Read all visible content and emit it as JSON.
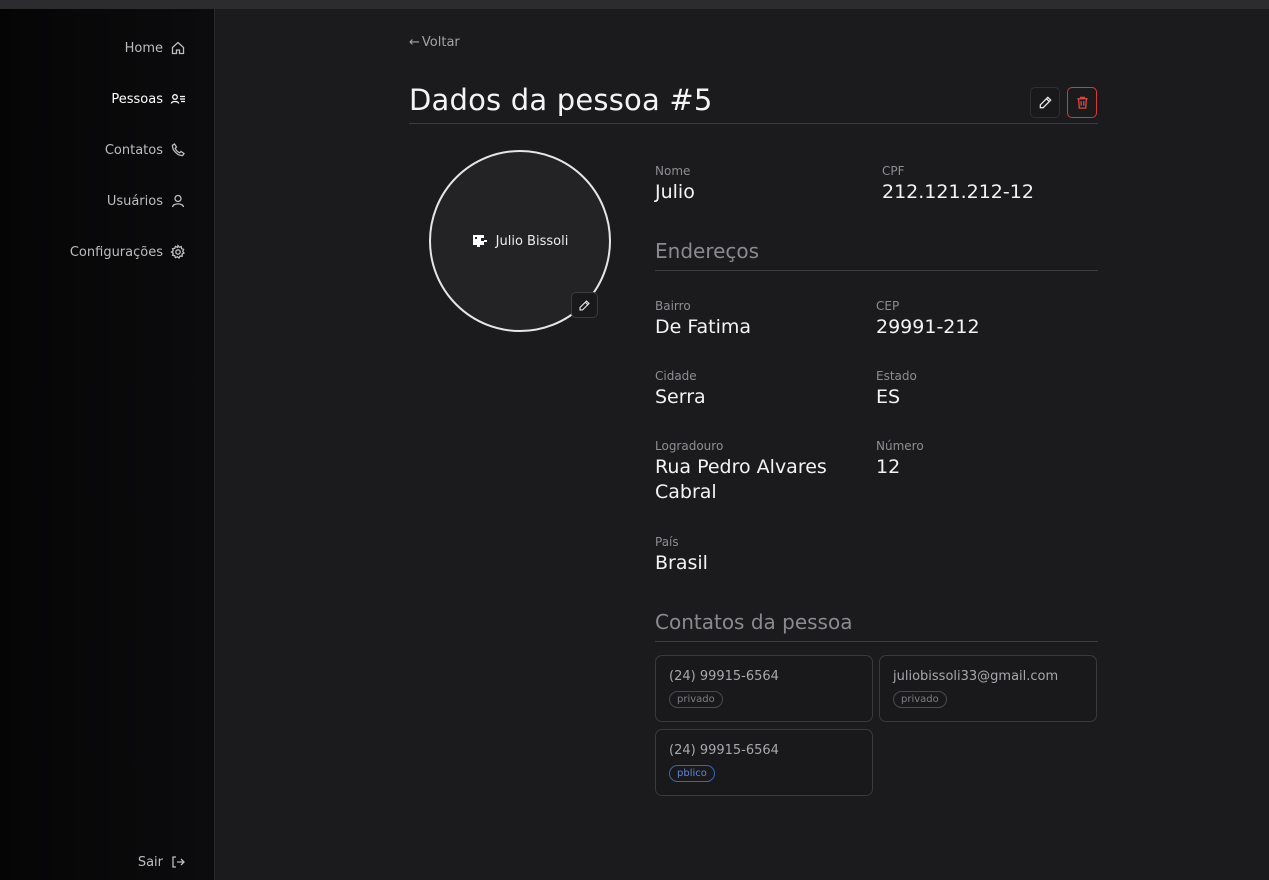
{
  "sidebar": {
    "items": [
      {
        "label": "Home",
        "icon": "home-icon"
      },
      {
        "label": "Pessoas",
        "icon": "people-list-icon",
        "active": true
      },
      {
        "label": "Contatos",
        "icon": "phone-icon"
      },
      {
        "label": "Usuários",
        "icon": "user-icon"
      },
      {
        "label": "Configurações",
        "icon": "gear-icon"
      }
    ],
    "logout_label": "Sair"
  },
  "header": {
    "back_label": "Voltar",
    "title": "Dados da pessoa #5"
  },
  "avatar": {
    "alt_text": "Julio Bissoli"
  },
  "person": {
    "nome_label": "Nome",
    "nome": "Julio",
    "cpf_label": "CPF",
    "cpf": "212.121.212-12"
  },
  "address": {
    "section_title": "Endereços",
    "bairro_label": "Bairro",
    "bairro": "De Fatima",
    "cep_label": "CEP",
    "cep": "29991-212",
    "cidade_label": "Cidade",
    "cidade": "Serra",
    "estado_label": "Estado",
    "estado": "ES",
    "logradouro_label": "Logradouro",
    "logradouro": "Rua Pedro Alvares Cabral",
    "numero_label": "Número",
    "numero": "12",
    "pais_label": "País",
    "pais": "Brasil"
  },
  "contacts": {
    "section_title": "Contatos da pessoa",
    "items": [
      {
        "value": "(24) 99915-6564",
        "visibility": "privado"
      },
      {
        "value": "juliobissoli33@gmail.com",
        "visibility": "privado"
      },
      {
        "value": "(24) 99915-6564",
        "visibility": "pblico"
      }
    ]
  },
  "colors": {
    "background": "#1b1b1d",
    "sidebar": "#0a0a0b",
    "delete_accent": "#d43a3a",
    "public_badge": "#3e63b5"
  }
}
